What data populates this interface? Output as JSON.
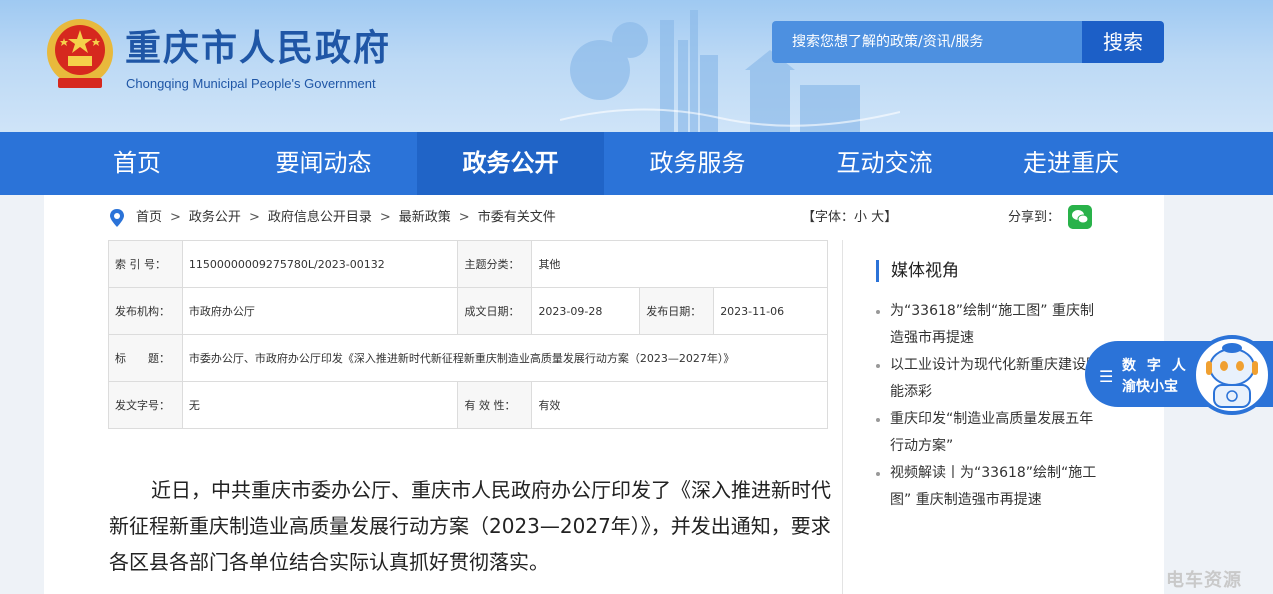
{
  "header": {
    "title": "重庆市人民政府",
    "subtitle": "Chongqing Municipal People's Government",
    "search": {
      "placeholder": "搜索您想了解的政策/资讯/服务",
      "button": "搜索"
    }
  },
  "nav": {
    "items": [
      "首页",
      "要闻动态",
      "政务公开",
      "政务服务",
      "互动交流",
      "走进重庆"
    ],
    "active": "政务公开"
  },
  "breadcrumb": [
    "首页",
    "政务公开",
    "政府信息公开目录",
    "最新政策",
    "市委有关文件"
  ],
  "font_size": {
    "prefix": "【字体：",
    "small": "小",
    "large": "大",
    "suffix": "】"
  },
  "share_label": "分享到：",
  "info": {
    "index_label": "索 引 号：",
    "index_value": "11500000009275780L/2023-00132",
    "topic_label": "主题分类：",
    "topic_value": "其他",
    "issuer_label": "发布机构：",
    "issuer_value": "市政府办公厅",
    "written_label": "成文日期：",
    "written_value": "2023-09-28",
    "published_label": "发布日期：",
    "published_value": "2023-11-06",
    "title_label": "标　　题：",
    "title_value": "市委办公厅、市政府办公厅印发《深入推进新时代新征程新重庆制造业高质量发展行动方案（2023—2027年）》",
    "docno_label": "发文字号：",
    "docno_value": "无",
    "validity_label": "有 效 性：",
    "validity_value": "有效"
  },
  "article": {
    "paragraph": "近日，中共重庆市委办公厅、重庆市人民政府办公厅印发了《深入推进新时代新征程新重庆制造业高质量发展行动方案（2023—2027年）》，并发出通知，要求各区县各部门各单位结合实际认真抓好贯彻落实。"
  },
  "sidebar": {
    "title": "媒体视角",
    "items": [
      "为“33618”绘制“施工图” 重庆制造强市再提速",
      "以工业设计为现代化新重庆建设赋能添彩",
      "重庆印发“制造业高质量发展五年行动方案”",
      "视频解读丨为“33618”绘制“施工图” 重庆制造强市再提速"
    ]
  },
  "assistant": {
    "line1": "数 字 人",
    "line2": "渝快小宝"
  },
  "watermark": "电车资源",
  "colors": {
    "nav_bg": "#2b73d8",
    "nav_active": "#2064c7",
    "title": "#1f56a6",
    "search_btn": "#1c5fc7"
  }
}
